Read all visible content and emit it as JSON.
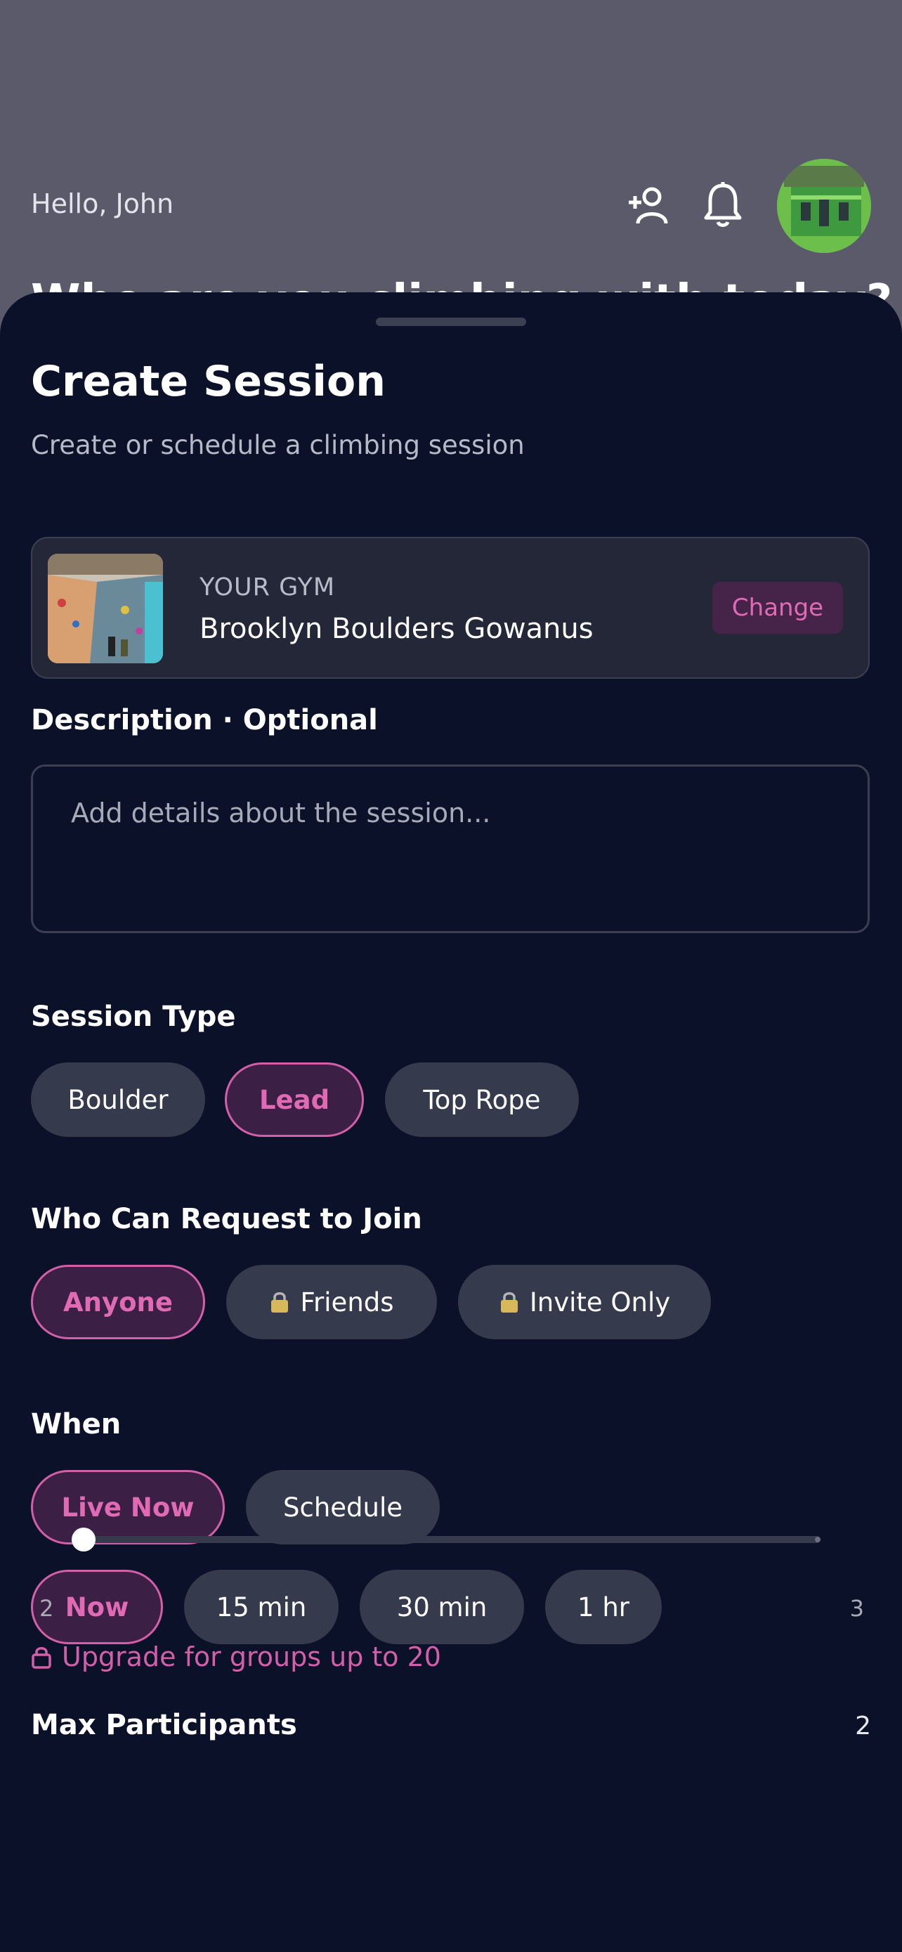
{
  "background": {
    "greeting": "Hello, John",
    "heading": "Who are you climbing with today?",
    "icons": [
      "add-friend-icon",
      "bell-icon"
    ]
  },
  "sheet": {
    "title": "Create Session",
    "subtitle": "Create or schedule a climbing session",
    "gym": {
      "label": "YOUR GYM",
      "name": "Brooklyn Boulders Gowanus",
      "change_label": "Change"
    },
    "description": {
      "label": "Description · Optional",
      "placeholder": "Add details about the session..."
    },
    "session_type": {
      "label": "Session Type",
      "options": [
        "Boulder",
        "Lead",
        "Top Rope"
      ],
      "selected": "Lead"
    },
    "join": {
      "label": "Who Can Request to Join",
      "options": [
        "Anyone",
        "Friends",
        "Invite Only"
      ],
      "selected": "Anyone"
    },
    "when": {
      "label": "When",
      "modes": [
        "Live Now",
        "Schedule"
      ],
      "selected_mode": "Live Now",
      "times": [
        "Now",
        "15 min",
        "30 min",
        "1 hr"
      ],
      "selected_time": "Now"
    },
    "max_participants": {
      "label": "Max Participants",
      "value": "2",
      "min": "2",
      "max": "3"
    },
    "upgrade_text": "Upgrade for groups up to 20"
  },
  "colors": {
    "accent": "#e06bb4",
    "sheet_bg": "#0b1128",
    "chip_bg": "#353a4c"
  }
}
